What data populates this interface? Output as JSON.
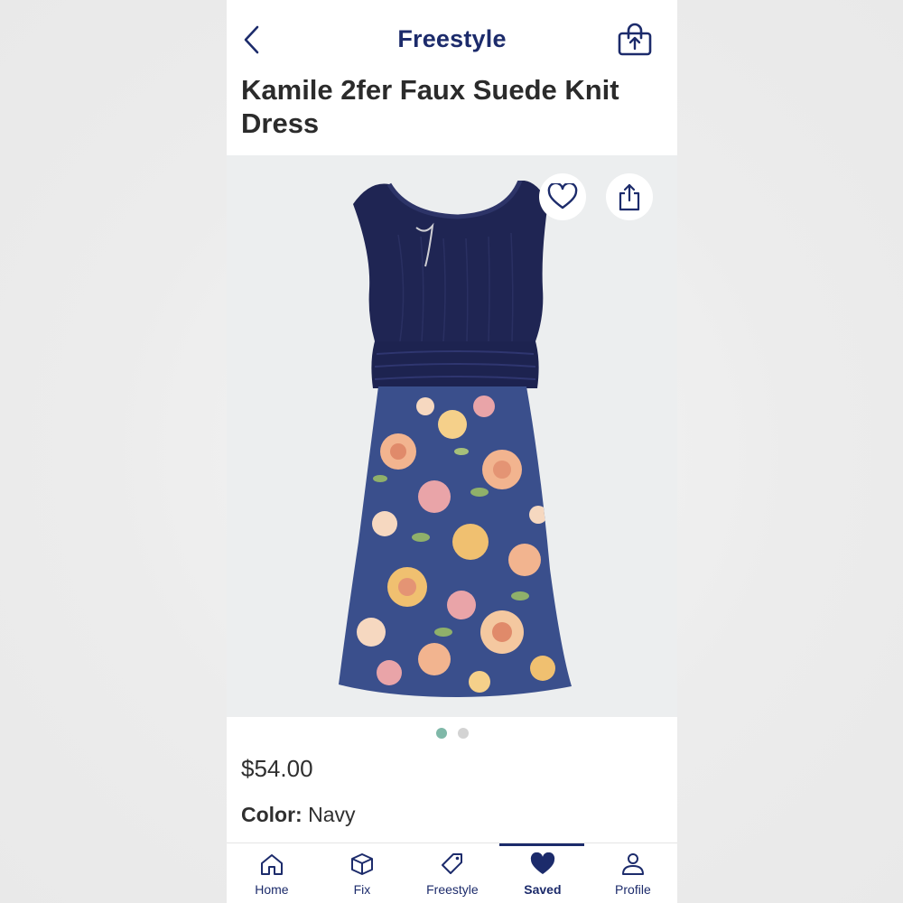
{
  "header": {
    "title": "Freestyle",
    "back_icon": "chevron-left-icon",
    "bag_icon": "shopping-bag-icon"
  },
  "product": {
    "name": "Kamile 2fer Faux Suede Knit Dress",
    "price": "$54.00",
    "color_label": "Color:",
    "color_value": "Navy"
  },
  "gallery": {
    "favorite_icon": "heart-outline-icon",
    "share_icon": "share-icon",
    "page_count": 2,
    "active_page": 1
  },
  "tabs": [
    {
      "label": "Home",
      "icon": "home-icon",
      "active": false
    },
    {
      "label": "Fix",
      "icon": "box-icon",
      "active": false
    },
    {
      "label": "Freestyle",
      "icon": "tag-icon",
      "active": false
    },
    {
      "label": "Saved",
      "icon": "heart-filled-icon",
      "active": true
    },
    {
      "label": "Profile",
      "icon": "person-icon",
      "active": false
    }
  ],
  "colors": {
    "brand_navy": "#1c2b6b",
    "dot_active": "#7fb8a8",
    "dot_inactive": "#d3d3d3"
  }
}
